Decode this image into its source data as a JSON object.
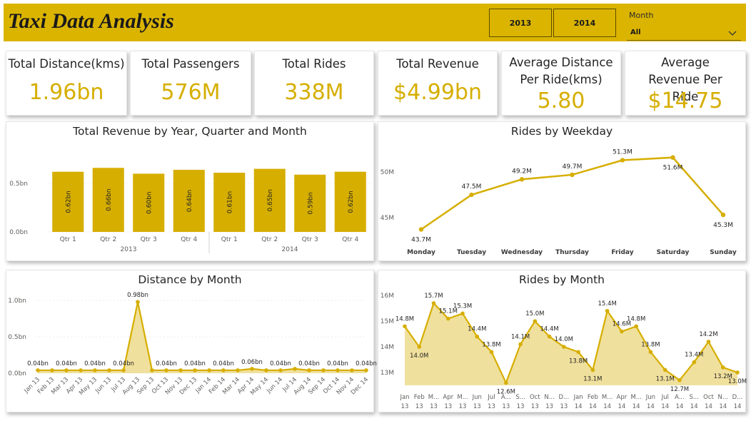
{
  "header": {
    "title": "Taxi Data Analysis",
    "year_buttons": [
      "2013",
      "2014"
    ],
    "month_filter_label": "Month",
    "month_filter_value": "All"
  },
  "kpis": [
    {
      "label": "Total Distance(kms)",
      "value": "1.96bn"
    },
    {
      "label": "Total Passengers",
      "value": "576M"
    },
    {
      "label": "Total Rides",
      "value": "338M"
    },
    {
      "label": "Total Revenue",
      "value": "$4.99bn"
    },
    {
      "label": "Average Distance Per Ride(kms)",
      "value": "5.80"
    },
    {
      "label": "Average Revenue Per Ride",
      "value": "$14.75"
    }
  ],
  "colors": {
    "header": "#DBB400",
    "accent": "#D6AE00",
    "area": "#EDDA8C"
  },
  "panels": {
    "revenue": {
      "title": "Total Revenue by Year, Quarter and Month"
    },
    "weekday": {
      "title": "Rides by Weekday"
    },
    "distance": {
      "title": "Distance by Month"
    },
    "rides_month": {
      "title": "Rides by Month"
    }
  },
  "chart_data": [
    {
      "type": "bar",
      "title": "Total Revenue by Year, Quarter and Month",
      "categories": [
        "Qtr 1",
        "Qtr 2",
        "Qtr 3",
        "Qtr 4",
        "Qtr 1",
        "Qtr 2",
        "Qtr 3",
        "Qtr 4"
      ],
      "groups": [
        {
          "label": "2013",
          "count": 4
        },
        {
          "label": "2014",
          "count": 4
        }
      ],
      "values": [
        0.62,
        0.66,
        0.6,
        0.64,
        0.61,
        0.65,
        0.59,
        0.62
      ],
      "data_labels": [
        "0.62bn",
        "0.66bn",
        "0.60bn",
        "0.64bn",
        "0.61bn",
        "0.65bn",
        "0.59bn",
        "0.62bn"
      ],
      "yticks": [
        {
          "v": 0,
          "label": "0.0bn"
        },
        {
          "v": 0.5,
          "label": "0.5bn"
        }
      ],
      "ylim": [
        0,
        0.75
      ]
    },
    {
      "type": "line",
      "title": "Rides by Weekday",
      "categories": [
        "Monday",
        "Tuesday",
        "Wednesday",
        "Thursday",
        "Friday",
        "Saturday",
        "Sunday"
      ],
      "values": [
        43.7,
        47.5,
        49.2,
        49.7,
        51.3,
        51.6,
        45.3
      ],
      "data_labels": [
        "43.7M",
        "47.5M",
        "49.2M",
        "49.7M",
        "51.3M",
        "51.6M",
        "45.3M"
      ],
      "yticks": [
        {
          "v": 45,
          "label": "45M"
        },
        {
          "v": 50,
          "label": "50M"
        }
      ],
      "ylim": [
        42.8,
        53.3
      ]
    },
    {
      "type": "area",
      "title": "Distance by Month",
      "x": [
        "Jan 13",
        "Feb 13",
        "Mar 13",
        "Apr 13",
        "May 13",
        "Jun 13",
        "Jul 13",
        "Aug 13",
        "Sep 13",
        "Oct 13",
        "Nov 13",
        "Dec 13",
        "Jan 14",
        "Feb 14",
        "Mar 14",
        "Apr 14",
        "May 14",
        "Jun 14",
        "Jul 14",
        "Aug 14",
        "Sep 14",
        "Oct 14",
        "Nov 14",
        "Dec 14"
      ],
      "x_tick_labels": [
        "Jan 13",
        "Feb 13",
        "Mar 13",
        "Apr 13",
        "May 13",
        "Jun 13",
        "Jul 13",
        "Aug 13",
        "Sep 13",
        "Oct 13",
        "Nov 13",
        "Dec 13",
        "Jan 14",
        "Feb 14",
        "Mar 14",
        "Apr 14",
        "May 14",
        "Jun 14",
        "Jul 14",
        "Aug 14",
        "Sep 14",
        "Oct 14",
        "Nov 14",
        "Dec 14"
      ],
      "values": [
        0.04,
        0.04,
        0.04,
        0.04,
        0.04,
        0.04,
        0.04,
        0.98,
        0.04,
        0.04,
        0.04,
        0.04,
        0.04,
        0.04,
        0.04,
        0.06,
        0.04,
        0.04,
        0.06,
        0.04,
        0.04,
        0.04,
        0.04,
        0.04
      ],
      "data_labels": {
        "0": "0.04bn",
        "2": "0.04bn",
        "4": "0.04bn",
        "6": "0.04bn",
        "7": "0.98bn",
        "9": "0.04bn",
        "11": "0.04bn",
        "13": "0.04bn",
        "15": "0.06bn",
        "17": "0.04bn",
        "19": "0.04bn",
        "21": "0.04bn",
        "23": "0.04bn"
      },
      "yticks": [
        {
          "v": 0,
          "label": "0.0bn"
        },
        {
          "v": 0.5,
          "label": "0.5bn"
        },
        {
          "v": 1.0,
          "label": "1.0bn"
        }
      ],
      "ylim": [
        0,
        1.1
      ]
    },
    {
      "type": "area",
      "title": "Rides by Month",
      "x": [
        "Jan 13",
        "Feb 13",
        "Mar 13",
        "Apr 13",
        "May 13",
        "Jun 13",
        "Jul 13",
        "Aug 13",
        "Sep 13",
        "Oct 13",
        "Nov 13",
        "Dec 13",
        "Jan 14",
        "Feb 14",
        "Mar 14",
        "Apr 14",
        "May 14",
        "Jun 14",
        "Jul 14",
        "Aug 14",
        "Sep 14",
        "Oct 14",
        "Nov 14",
        "Dec 14"
      ],
      "x_tick_top": [
        "Jan",
        "Feb",
        "M...",
        "Apr",
        "M...",
        "Jun",
        "Jul",
        "A...",
        "S...",
        "Oct",
        "N...",
        "D...",
        "Jan",
        "Feb",
        "M...",
        "Apr",
        "M...",
        "Jun",
        "Jul",
        "A...",
        "S...",
        "Oct",
        "N...",
        "D..."
      ],
      "x_tick_bottom": [
        "13",
        "13",
        "13",
        "13",
        "13",
        "13",
        "13",
        "13",
        "13",
        "13",
        "13",
        "13",
        "14",
        "14",
        "14",
        "14",
        "14",
        "14",
        "14",
        "14",
        "14",
        "14",
        "14",
        "14"
      ],
      "values": [
        14.8,
        14.0,
        15.7,
        15.1,
        15.3,
        14.4,
        13.8,
        12.6,
        14.1,
        15.0,
        14.4,
        14.0,
        13.8,
        13.1,
        15.4,
        14.6,
        14.8,
        13.8,
        13.1,
        12.7,
        13.4,
        14.2,
        13.2,
        13.0
      ],
      "data_labels": [
        "14.8M",
        "14.0M",
        "15.7M",
        "15.1M",
        "15.3M",
        "14.4M",
        "13.8M",
        "12.6M",
        "14.1M",
        "15.0M",
        "14.4M",
        "14.0M",
        "13.8M",
        "13.1M",
        "15.4M",
        "14.6M",
        "14.8M",
        "13.8M",
        "13.1M",
        "12.7M",
        "13.4M",
        "14.2M",
        "13.2M",
        "13.0M"
      ],
      "yticks": [
        {
          "v": 13,
          "label": "13M"
        },
        {
          "v": 14,
          "label": "14M"
        },
        {
          "v": 15,
          "label": "15M"
        },
        {
          "v": 16,
          "label": "16M"
        }
      ],
      "ylim": [
        12.5,
        16.2
      ]
    }
  ]
}
